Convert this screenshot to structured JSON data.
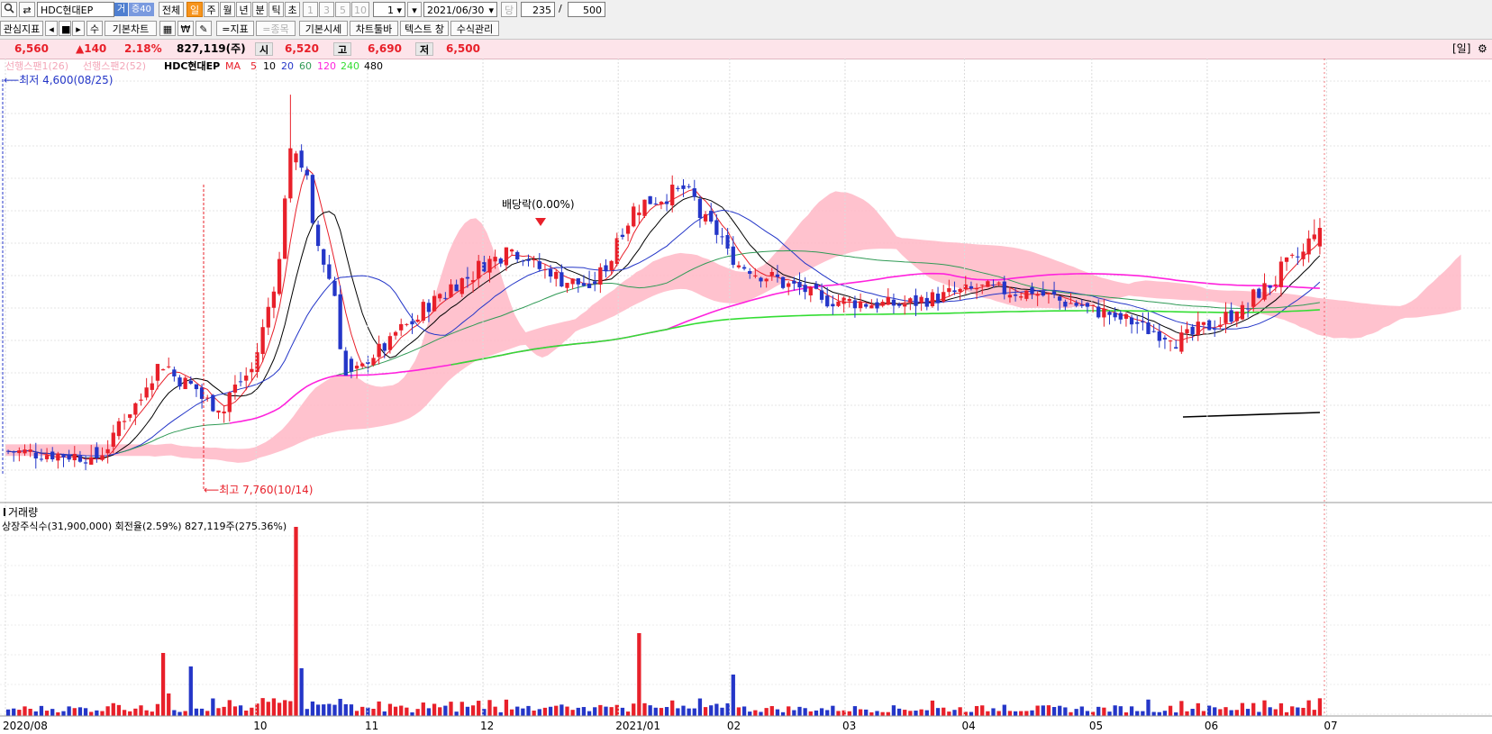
{
  "toolbar": {
    "symbol_name": "HDC현대EP",
    "badge_geo": "거",
    "badge_cheung": "증40",
    "period_all": "전체",
    "period_day": "일",
    "period_week": "주",
    "period_month": "월",
    "period_year": "년",
    "period_min": "분",
    "period_tick": "틱",
    "period_sec": "초",
    "n1": "1",
    "n3": "3",
    "n5": "5",
    "n10": "10",
    "interval_value": "1",
    "date_value": "2021/06/30",
    "dang": "당",
    "count_value": "235",
    "slash": "/",
    "total_value": "500"
  },
  "toolbar2": {
    "watch_label": "관심지표",
    "su": "수",
    "basic_chart": "기본차트",
    "indicator": "=지표",
    "item": "=종목",
    "basic_quote": "기본시세",
    "chart_toolbar": "차트툴바",
    "text_window": "텍스트 창",
    "formula": "수식관리"
  },
  "pricebar": {
    "price": "6,560",
    "change": "▲140",
    "rate": "2.18%",
    "volume": "827,119(주)",
    "open_label": "시",
    "open": "6,520",
    "high_label": "고",
    "high": "6,690",
    "low_label": "저",
    "low": "6,500",
    "period_tag": "[일]"
  },
  "legend": {
    "span1": "선행스팬1(26)",
    "span2": "선행스팬2(52)",
    "symbol": "HDC현대EP",
    "ma": "MA",
    "ma_periods": [
      "5",
      "10",
      "20",
      "60",
      "120",
      "240",
      "480"
    ]
  },
  "annotations": {
    "low_note": "최저 4,600(08/25)",
    "high_note": "최고 7,760(10/14)",
    "dividend": "배당락(0.00%)"
  },
  "volume_panel": {
    "title": "거래량",
    "info": "상장주식수(31,900,000) 회전율(2.59%) 827,119주(275.36%)"
  },
  "colors": {
    "up": "#e8202a",
    "down": "#2436c8",
    "cloud": "#ffb7c5",
    "ma5": "#e8202a",
    "ma10": "#000000",
    "ma20": "#2436c8",
    "ma60": "#2f9a55",
    "ma120": "#ff22dd",
    "ma240": "#33dd33",
    "ma480": "#000000"
  },
  "chart_data": {
    "type": "candlestick",
    "x_start": "2020/08/03",
    "x_end": "2021/06/30",
    "x_ticks": [
      "2020/08",
      "10",
      "11",
      "12",
      "2021/01",
      "02",
      "03",
      "04",
      "05",
      "06",
      "07"
    ],
    "y_range": [
      4500,
      7900
    ],
    "ohlc_anchors": [
      {
        "date": "2020/08/03",
        "close": 4700
      },
      {
        "date": "2020/08/25",
        "close": 4650,
        "low": 4600
      },
      {
        "date": "2020/09/10",
        "close": 5450
      },
      {
        "date": "2020/09/25",
        "close": 5050
      },
      {
        "date": "2020/10/05",
        "close": 5550
      },
      {
        "date": "2020/10/14",
        "close": 7300,
        "high": 7760
      },
      {
        "date": "2020/10/28",
        "close": 5350
      },
      {
        "date": "2020/11/20",
        "close": 6050
      },
      {
        "date": "2020/12/07",
        "close": 6450
      },
      {
        "date": "2020/12/18",
        "close": 6200
      },
      {
        "date": "2020/12/28",
        "close": 6100
      },
      {
        "date": "2021/01/08",
        "close": 6800
      },
      {
        "date": "2021/01/20",
        "close": 6950
      },
      {
        "date": "2021/02/03",
        "close": 6300
      },
      {
        "date": "2021/02/25",
        "close": 6000
      },
      {
        "date": "2021/03/15",
        "close": 5950
      },
      {
        "date": "2021/04/05",
        "close": 6100
      },
      {
        "date": "2021/04/20",
        "close": 6050
      },
      {
        "date": "2021/05/10",
        "close": 5850
      },
      {
        "date": "2021/05/25",
        "close": 5650
      },
      {
        "date": "2021/06/10",
        "close": 5900
      },
      {
        "date": "2021/06/30",
        "close": 6560,
        "open": 6520,
        "high": 6690,
        "low": 6500
      }
    ],
    "volume_note": "daily volume bars; spikes near 2020/09, 2020/10/14, 2021/01, 2021/02"
  }
}
